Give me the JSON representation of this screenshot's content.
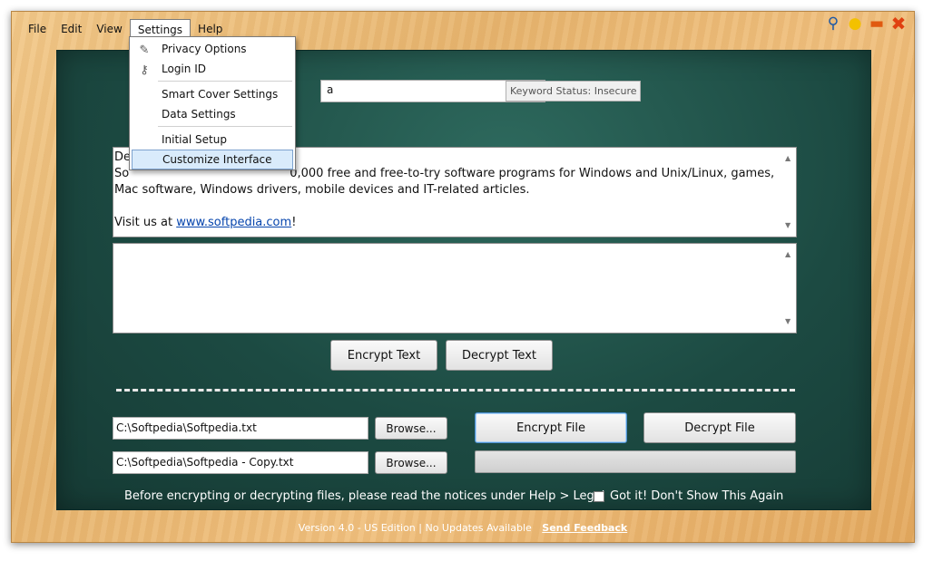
{
  "menubar": {
    "file": "File",
    "edit": "Edit",
    "view": "View",
    "settings": "Settings",
    "help": "Help"
  },
  "title_icons": [
    "search-icon",
    "lightbulb-icon",
    "minimize-icon",
    "close-icon"
  ],
  "settings_menu": {
    "items": [
      {
        "label": "Privacy Options",
        "icon": "privacy-icon"
      },
      {
        "label": "Login ID",
        "icon": "key-icon"
      },
      {
        "label": "Smart Cover Settings"
      },
      {
        "label": "Data Settings"
      },
      {
        "label": "Initial Setup"
      },
      {
        "label": "Customize Interface",
        "highlighted": true
      }
    ]
  },
  "keyword": {
    "value": "a",
    "status": "Keyword Status: Insecure"
  },
  "input_text": {
    "line1": "De",
    "line2_start": "So",
    "line2_end": "0,000 free and free-to-try software programs for Windows and Unix/Linux, games,",
    "line3": "Mac software, Windows drivers, mobile devices and IT-related articles.",
    "visit_prefix": "Visit us at ",
    "link": "www.softpedia.com",
    "visit_suffix": "!"
  },
  "output_text": "",
  "buttons": {
    "encrypt_text": "Encrypt Text",
    "decrypt_text": "Decrypt Text",
    "browse": "Browse...",
    "encrypt_file": "Encrypt File",
    "decrypt_file": "Decrypt File"
  },
  "files": {
    "source": "C:\\Softpedia\\Softpedia.txt",
    "destination": "C:\\Softpedia\\Softpedia - Copy.txt"
  },
  "progress": 0,
  "notice": "Before encrypting or decrypting files, please read the notices under Help > Legal",
  "dont_show": "Got it! Don't Show This Again",
  "footer": {
    "version": "Version 4.0 - US Edition | No Updates Available",
    "feedback": "Send Feedback"
  },
  "colors": {
    "wood": "#e7b56f",
    "board": "#1c4a42",
    "link": "#0645ad"
  }
}
